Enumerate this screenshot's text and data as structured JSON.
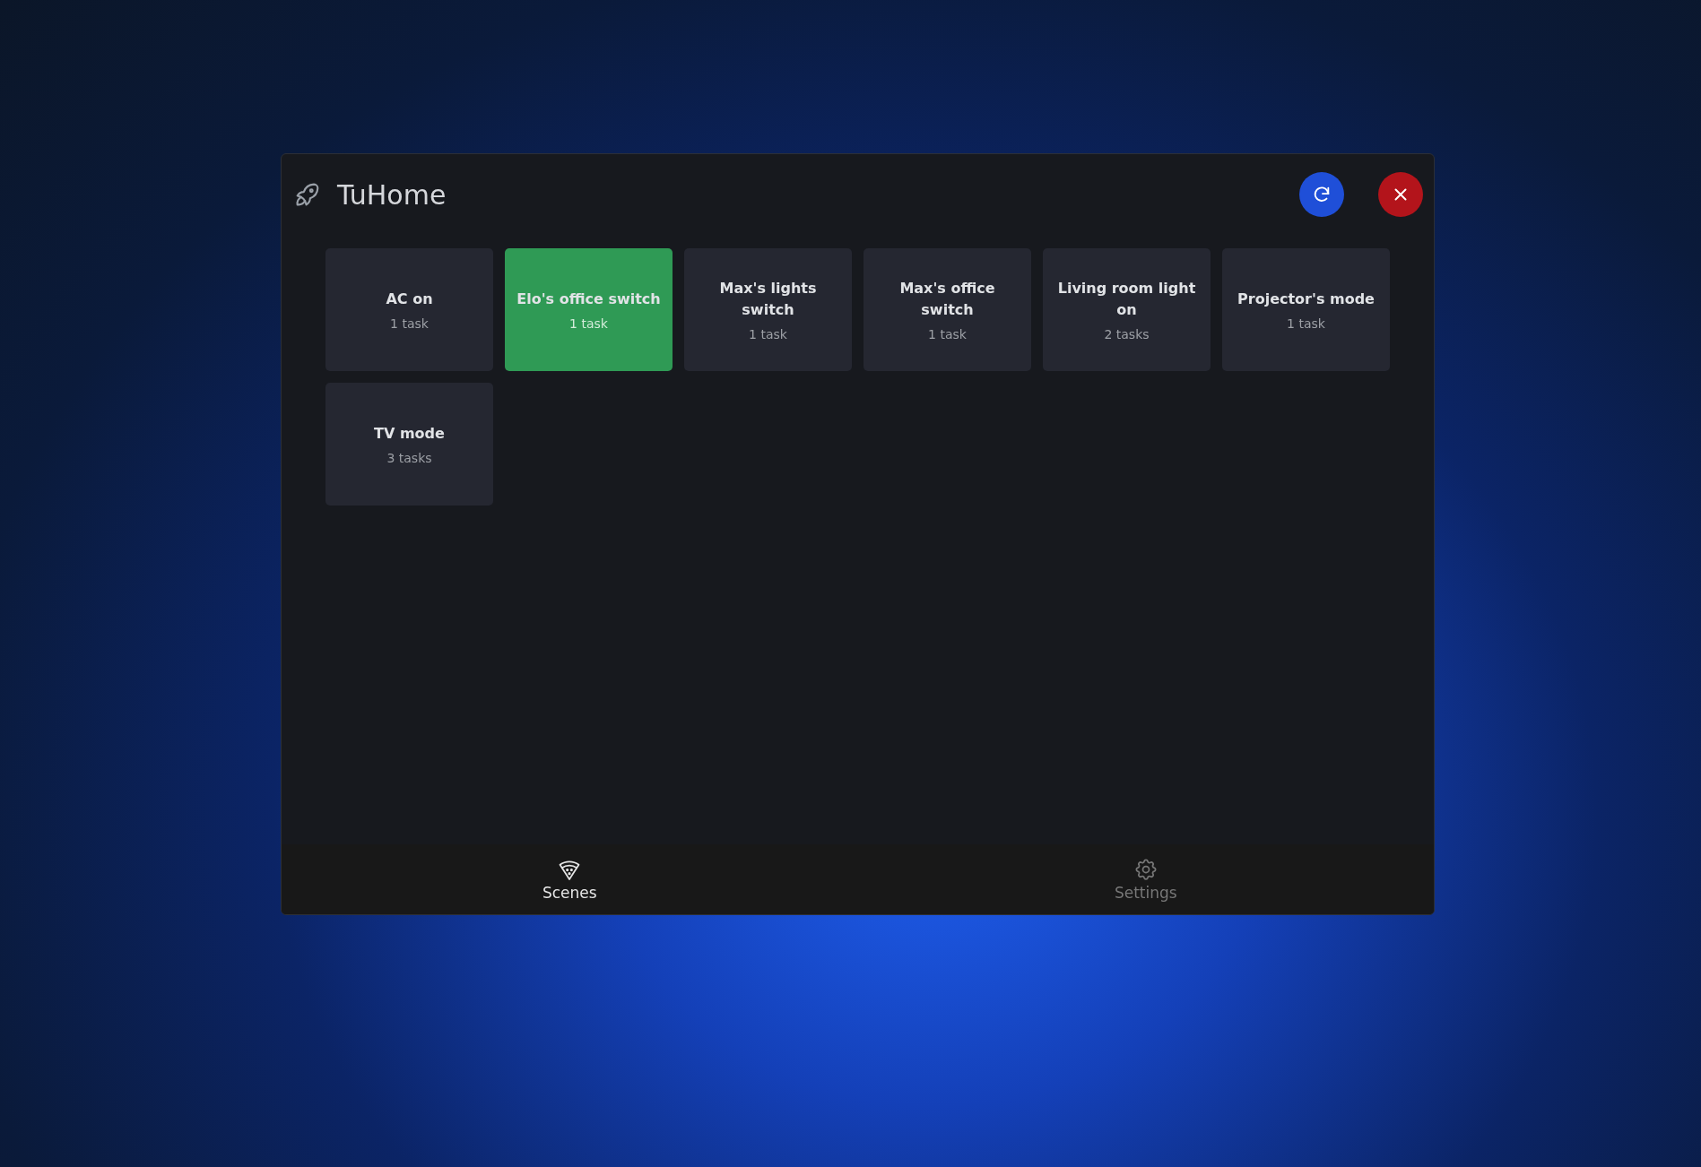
{
  "window": {
    "title": "TuHome"
  },
  "scenes": [
    {
      "name": "AC on",
      "tasks": "1 task",
      "selected": false
    },
    {
      "name": "Elo's office switch",
      "tasks": "1 task",
      "selected": true
    },
    {
      "name": "Max's lights switch",
      "tasks": "1 task",
      "selected": false
    },
    {
      "name": "Max's office switch",
      "tasks": "1 task",
      "selected": false
    },
    {
      "name": "Living room light on",
      "tasks": "2 tasks",
      "selected": false
    },
    {
      "name": "Projector's mode",
      "tasks": "1 task",
      "selected": false
    },
    {
      "name": "TV mode",
      "tasks": "3 tasks",
      "selected": false
    }
  ],
  "tabs": [
    {
      "label": "Scenes",
      "kind": "scenes",
      "selected": true
    },
    {
      "label": "Settings",
      "kind": "settings",
      "selected": false
    }
  ]
}
